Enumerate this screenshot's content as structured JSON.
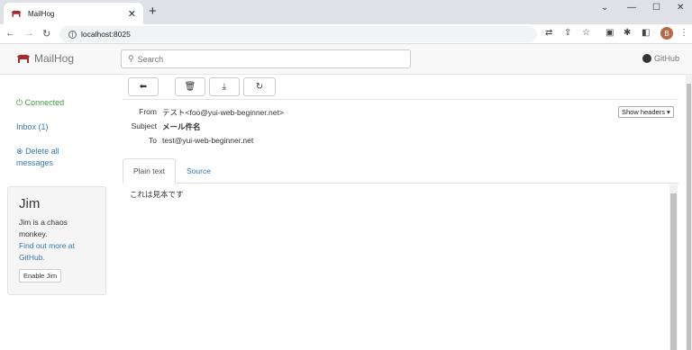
{
  "browser": {
    "tab_title": "MailHog",
    "url": "localhost:8025",
    "avatar_initial": "B"
  },
  "app": {
    "brand": "MailHog",
    "search_placeholder": "Search",
    "github_label": "GitHub"
  },
  "sidebar": {
    "connected": "Connected",
    "inbox": "Inbox (1)",
    "delete_all": "Delete all messages"
  },
  "jim": {
    "title": "Jim",
    "description": "Jim is a chaos monkey.",
    "link": "Find out more at GitHub.",
    "button": "Enable Jim"
  },
  "message": {
    "from_label": "From",
    "from_value": "テスト<foo@yui-web-beginner.net>",
    "subject_label": "Subject",
    "subject_value": "メール件名",
    "to_label": "To",
    "to_value": "test@yui-web-beginner.net",
    "show_headers": "Show headers",
    "tabs": [
      "Plain text",
      "Source"
    ],
    "body": "これは見本です"
  },
  "colors": {
    "link": "#337ab7",
    "connected": "#3c9a3c",
    "brand_icon": "#a52a2a"
  }
}
